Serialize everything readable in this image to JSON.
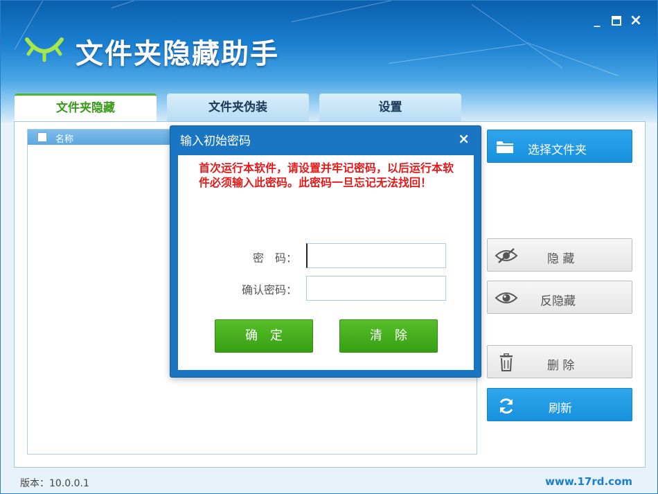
{
  "app": {
    "title": "文件夹隐藏助手"
  },
  "window_controls": {
    "minimize": "_",
    "maximize": "□",
    "close": "×"
  },
  "tabs": [
    {
      "label": "文件夹隐藏",
      "active": true
    },
    {
      "label": "文件夹伪装",
      "active": false
    },
    {
      "label": "设置",
      "active": false
    }
  ],
  "list": {
    "column_name": "名称"
  },
  "buttons": {
    "select_folder": "选择文件夹",
    "hide": "隐 藏",
    "unhide": "反隐藏",
    "delete": "删 除",
    "refresh": "刷新"
  },
  "status": {
    "version": "版本：10.0.0.1",
    "website": "www.17rd.com"
  },
  "dialog": {
    "title": "输入初始密码",
    "close": "×",
    "warning": "首次运行本软件，请设置并牢记密码，以后运行本软件必须输入此密码。此密码一旦忘记无法找回！",
    "password_label": "密　码：",
    "confirm_label": "确认密码：",
    "password_value": "",
    "confirm_value": "",
    "ok_label": "确定",
    "clear_label": "清除"
  },
  "colors": {
    "accent": "#1a8fde",
    "active_tab": "#3a9a1a",
    "warning": "#e41a1a",
    "confirm_button": "#46ae1c"
  },
  "icons": [
    "eye-logo-icon",
    "folder-icon",
    "eye-slash-icon",
    "eye-icon",
    "trash-icon",
    "refresh-icon"
  ]
}
